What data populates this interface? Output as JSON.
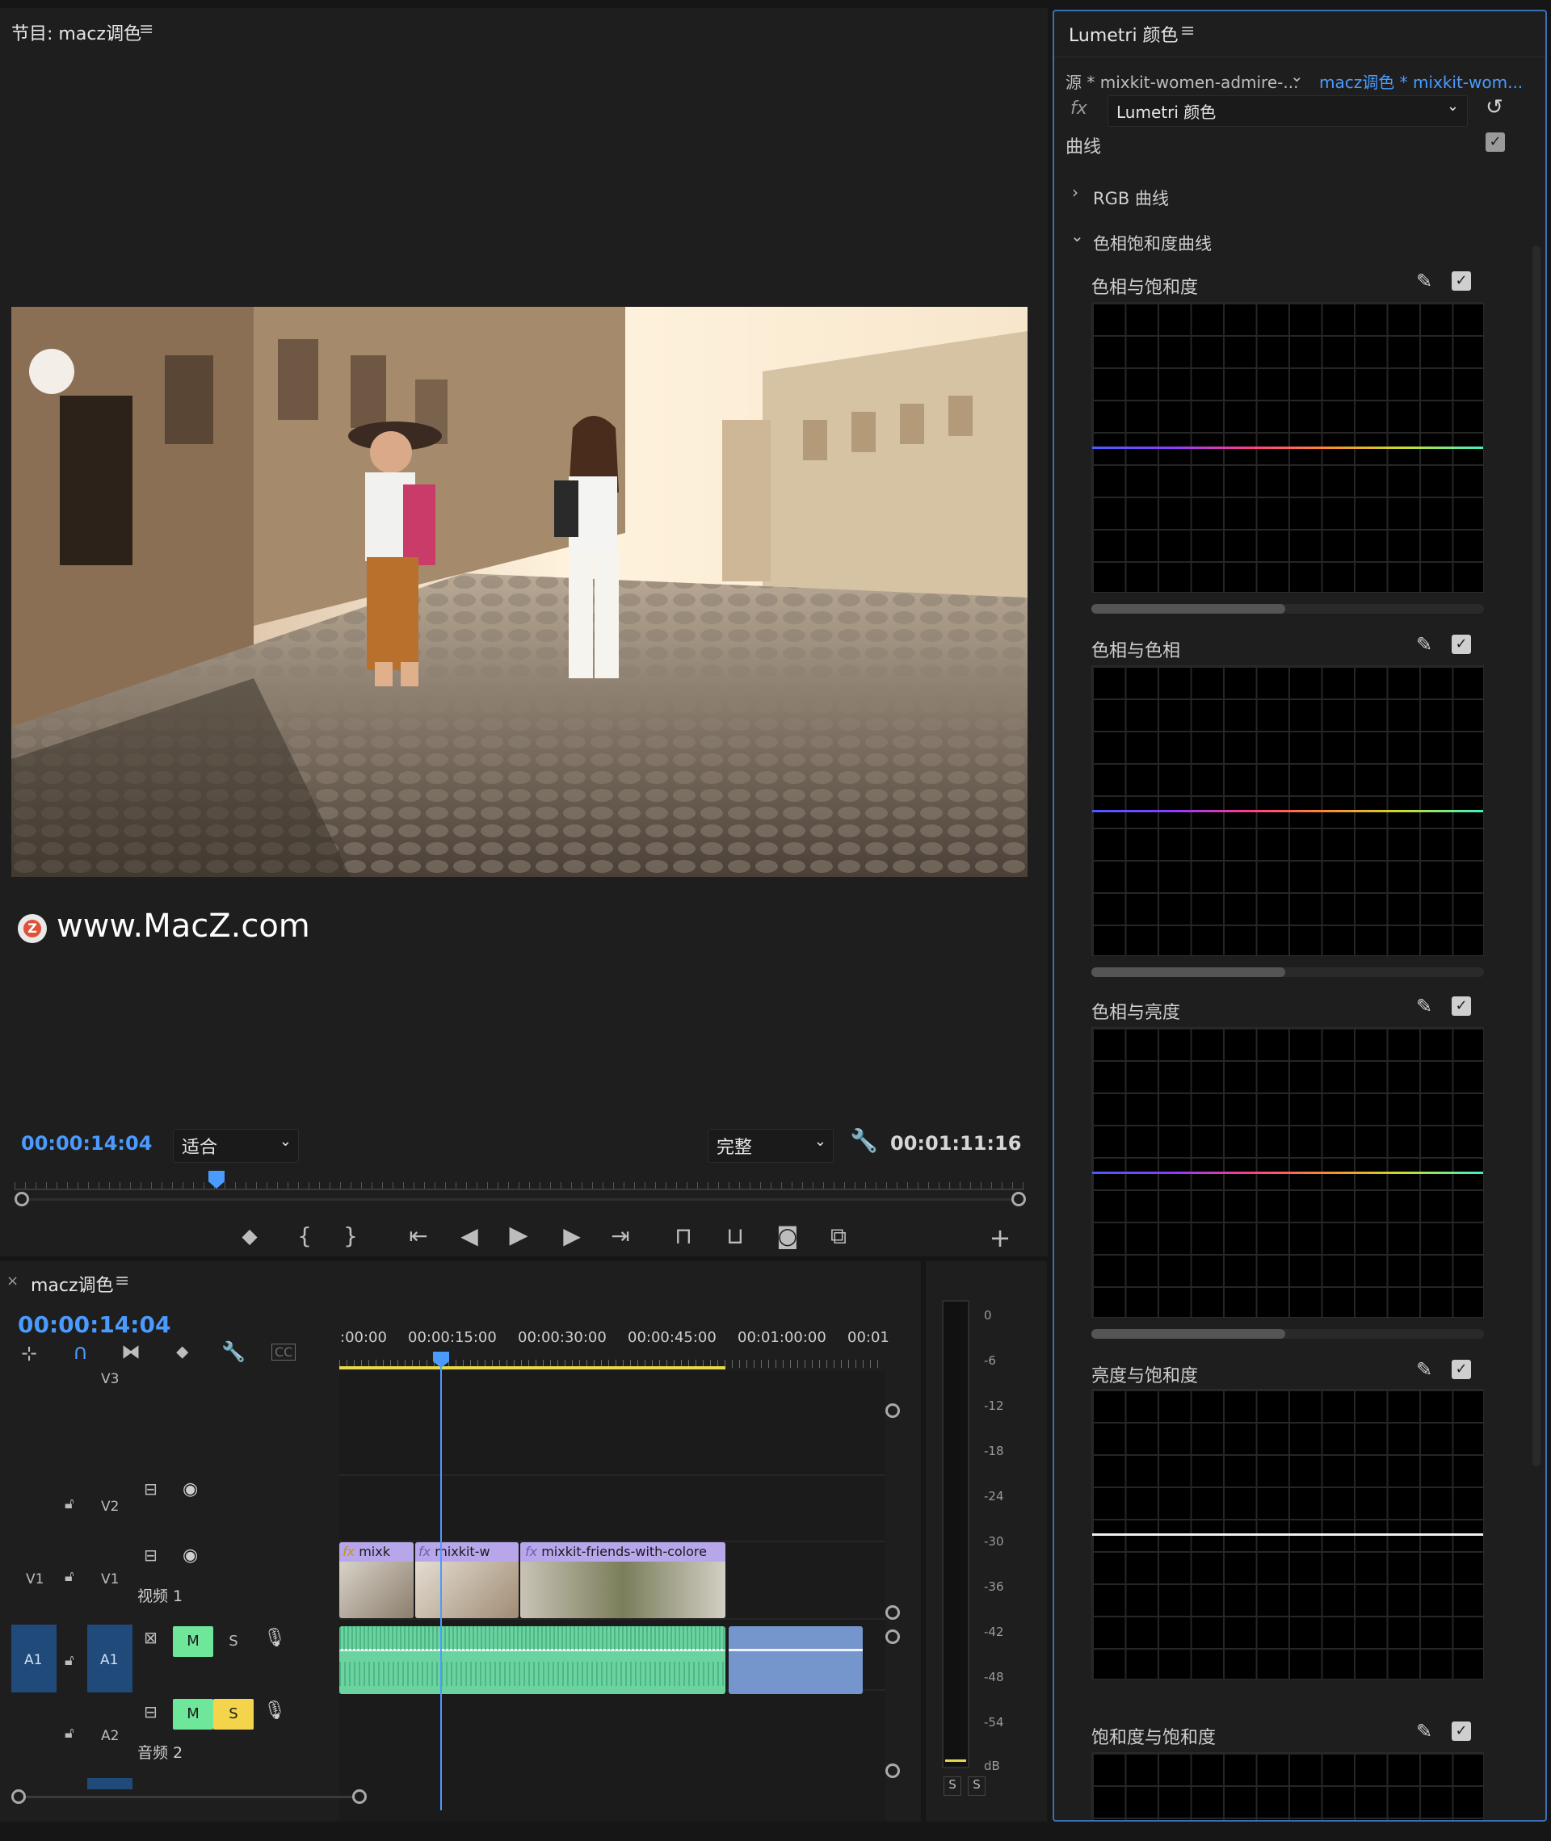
{
  "program": {
    "title": "节目: macz调色",
    "watermark": "www.MacZ.com",
    "current_time": "00:00:14:04",
    "fit": "适合",
    "quality": "完整",
    "duration": "00:01:11:16",
    "playhead_fraction": 0.2
  },
  "lumetri": {
    "title": "Lumetri 颜色",
    "source_label": "源 * mixkit-women-admire-...",
    "target_label": "macz调色 * mixkit-wom...",
    "effect_label": "Lumetri 颜色",
    "fx_label": "fx",
    "curves_title": "曲线",
    "rgb_curves": "RGB 曲线",
    "hue_sat_curves": "色相饱和度曲线",
    "graphs": [
      {
        "label": "色相与饱和度",
        "line": "rainbow"
      },
      {
        "label": "色相与色相",
        "line": "rainbow"
      },
      {
        "label": "色相与亮度",
        "line": "rainbow"
      },
      {
        "label": "亮度与饱和度",
        "line": "white"
      },
      {
        "label": "饱和度与饱和度",
        "line": "none"
      }
    ]
  },
  "timeline": {
    "tab_close": "×",
    "title": "macz调色",
    "timecode": "00:00:14:04",
    "ruler": [
      ":00:00",
      "00:00:15:00",
      "00:00:30:00",
      "00:00:45:00",
      "00:01:00:00",
      "00:01"
    ],
    "tracks": {
      "v3": "V3",
      "v2": "V2",
      "v1_src": "V1",
      "v1": "V1",
      "video1_name": "视频 1",
      "a1_src": "A1",
      "a1": "A1",
      "a2": "A2",
      "audio2_name": "音频 2",
      "m": "M",
      "s": "S"
    },
    "clips": [
      {
        "label": "mixk",
        "fx": "fx"
      },
      {
        "label": "mixkit-w",
        "fx": "fx"
      },
      {
        "label": "mixkit-friends-with-colore",
        "fx": "fx"
      }
    ]
  },
  "meter": {
    "scale": [
      "0",
      "-6",
      "-12",
      "-18",
      "-24",
      "-30",
      "-36",
      "-42",
      "-48",
      "-54",
      "dB"
    ],
    "solo_left": "S",
    "solo_right": "S"
  },
  "colors": {
    "accent": "#4b9bff",
    "panel_border": "#3b6fb3",
    "audio_clip": "#6ad3a0",
    "video_clip_header": "#b7a7ea",
    "mute_button": "#6ee79b",
    "solo_button": "#f4d44a"
  }
}
